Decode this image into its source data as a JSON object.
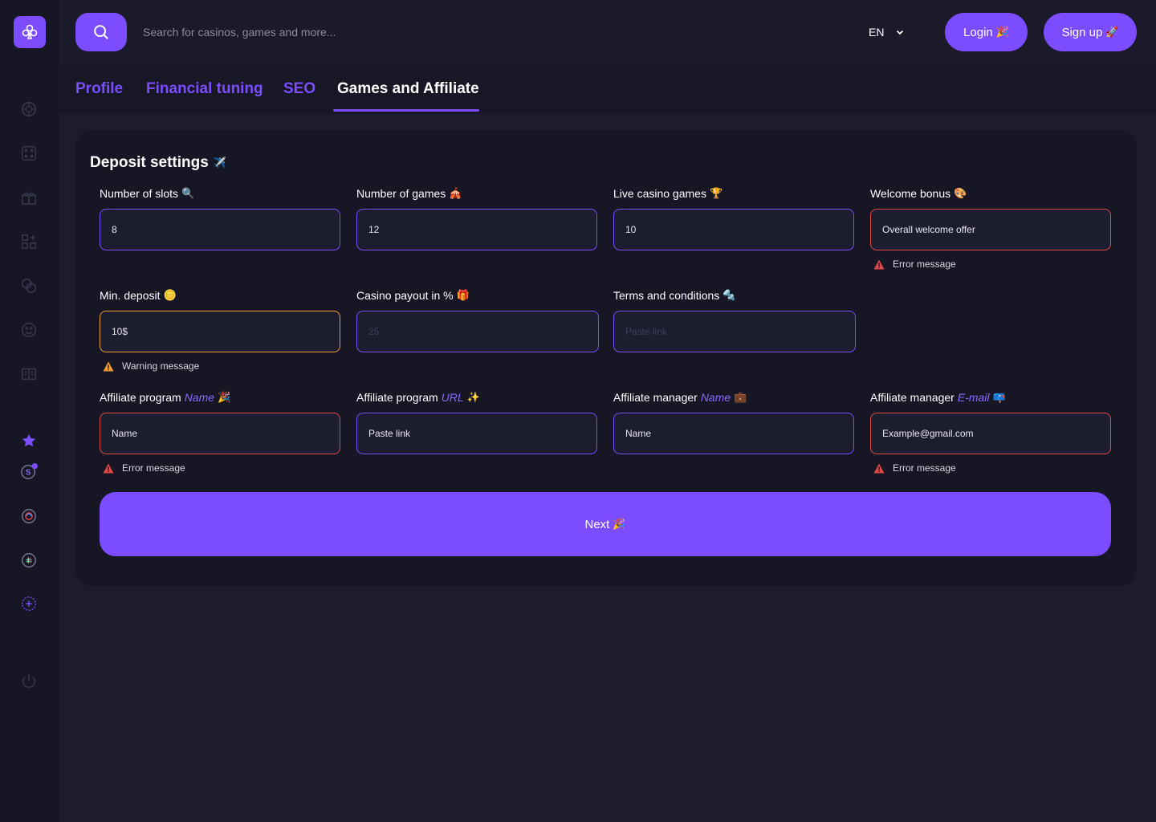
{
  "header": {
    "search_placeholder": "Search for casinos, games and more...",
    "language": "EN",
    "login_label": "Login",
    "login_emoji": "🎉",
    "signup_label": "Sign up",
    "signup_emoji": "🚀"
  },
  "sidebar": {
    "icons": [
      "club-logo-icon",
      "poker-chip-icon",
      "dice-icon",
      "gift-icon",
      "add-widget-icon",
      "coins-icon",
      "face-icon",
      "book-icon",
      "star-icon",
      "skrill-icon",
      "opera-icon",
      "slack-icon",
      "add-circle-icon",
      "power-icon"
    ]
  },
  "tabs": [
    {
      "label": "Profile",
      "active": false
    },
    {
      "label": "Financial tuning",
      "active": false
    },
    {
      "label": "SEO",
      "active": false
    },
    {
      "label": "Games and Affiliate",
      "active": true
    }
  ],
  "card": {
    "title": "Deposit settings",
    "title_emoji": "✈️",
    "fields": {
      "slots": {
        "label": "Number of slots",
        "emoji": "🔍",
        "value": "8"
      },
      "games": {
        "label": "Number of games",
        "emoji": "🎪",
        "value": "12"
      },
      "live": {
        "label": "Live casino games",
        "emoji": "🏆",
        "value": "10"
      },
      "welcome": {
        "label": "Welcome bonus",
        "emoji": "🎨",
        "value": "Overall welcome offer",
        "message": "Error message"
      },
      "min_deposit": {
        "label": "Min. deposit",
        "emoji": "🪙",
        "value": "10$",
        "message": "Warning message"
      },
      "payout": {
        "label": "Casino payout in %",
        "emoji": "🎁",
        "placeholder": "25"
      },
      "terms": {
        "label": "Terms and conditions",
        "emoji": "🔩",
        "placeholder": "Paste link"
      },
      "aff_name": {
        "label": "Affiliate program",
        "label_em": "Name",
        "emoji": "🎉",
        "value": "Name",
        "message": "Error message"
      },
      "aff_url": {
        "label": "Affiliate program",
        "label_em": "URL",
        "emoji": "✨",
        "value": "Paste link"
      },
      "mgr_name": {
        "label": "Affiliate manager",
        "label_em": "Name",
        "emoji": "💼",
        "value": "Name"
      },
      "mgr_email": {
        "label": "Affiliate manager",
        "label_em": "E-mail",
        "emoji": "📪",
        "value": "Example@gmail.com",
        "message": "Error message"
      }
    },
    "next_label": "Next",
    "next_emoji": "🎉"
  },
  "colors": {
    "accent": "#7b4dff",
    "error": "#e04848",
    "warning": "#f0a030",
    "background": "#1c1c2e"
  }
}
